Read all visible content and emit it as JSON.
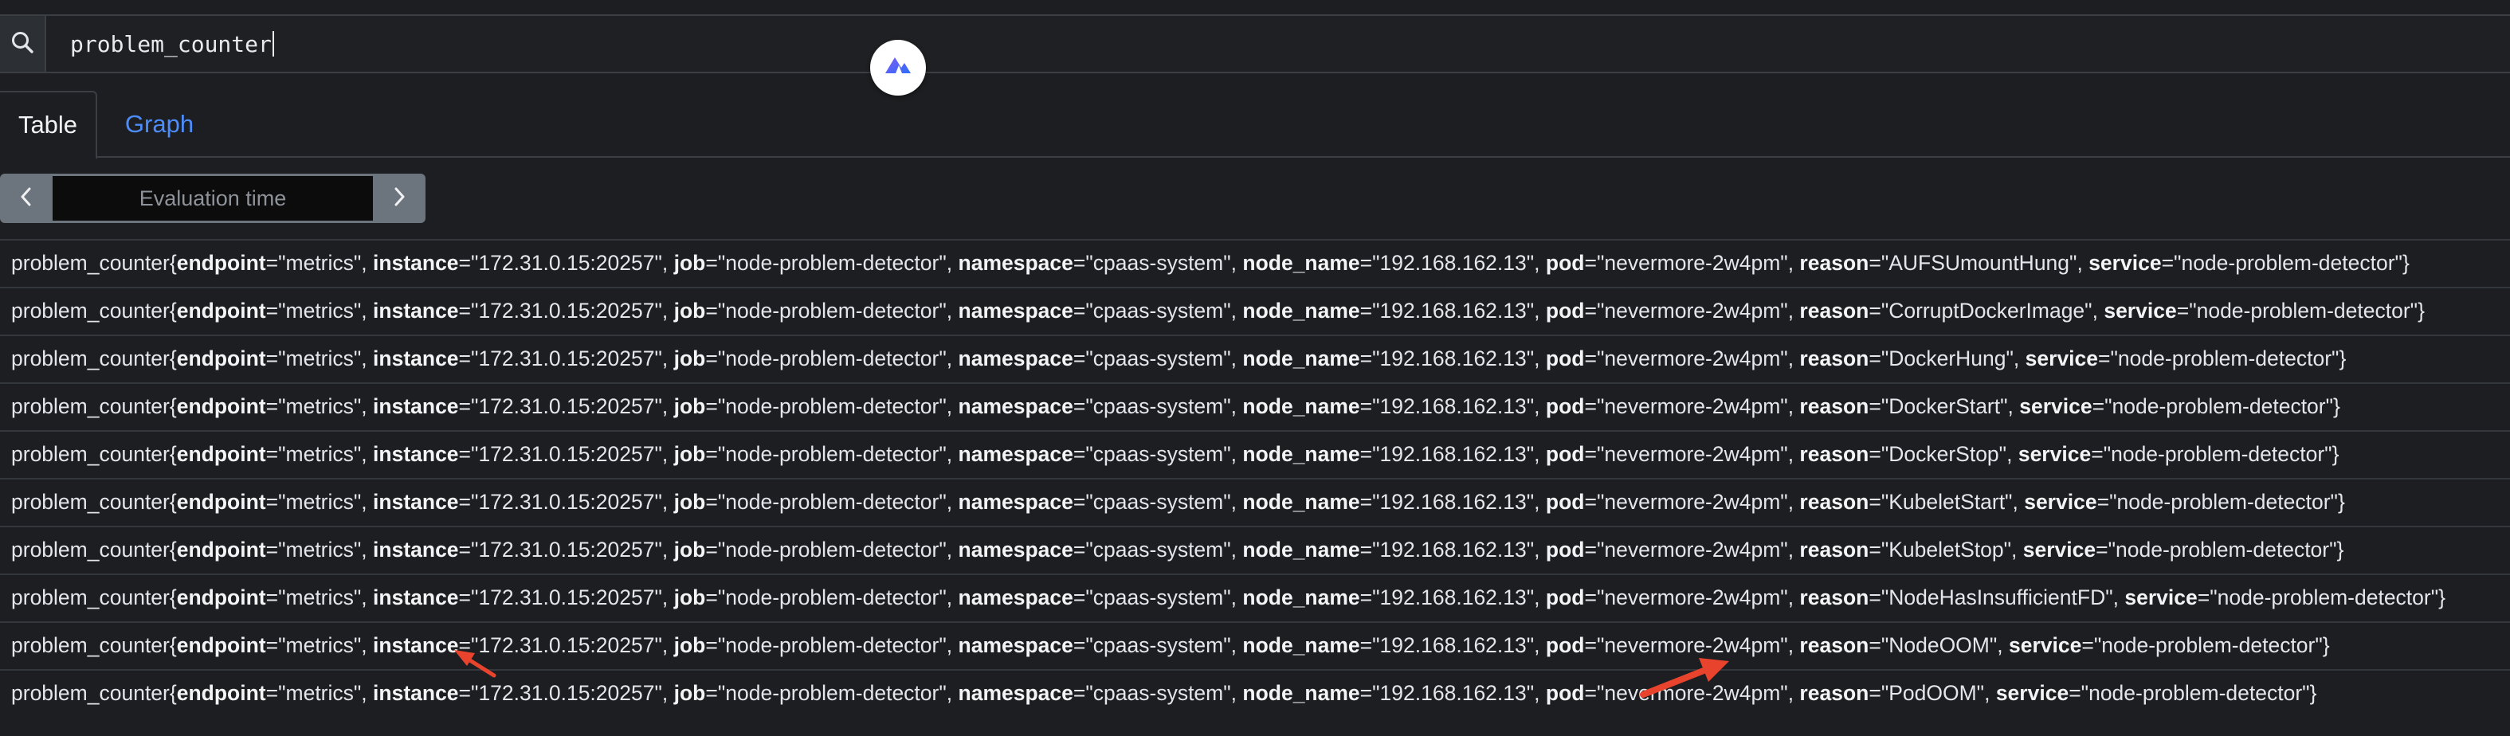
{
  "query": {
    "value": "problem_counter"
  },
  "icons": {
    "search": "search-icon",
    "extension": "extension-badge-icon",
    "prev": "chevron-left-icon",
    "next": "chevron-right-icon"
  },
  "tabs": {
    "table": "Table",
    "graph": "Graph"
  },
  "eval_time": {
    "placeholder": "Evaluation time"
  },
  "colors": {
    "accent": "#4d8dfb",
    "annotation_arrow": "#e8442d"
  },
  "labels": {
    "metric": "problem_counter",
    "endpoint_key": "endpoint",
    "instance_key": "instance",
    "job_key": "job",
    "namespace_key": "namespace",
    "node_name_key": "node_name",
    "pod_key": "pod",
    "reason_key": "reason",
    "service_key": "service",
    "endpoint_val": "\"metrics\"",
    "instance_val": "\"172.31.0.15:20257\"",
    "job_val": "\"node-problem-detector\"",
    "namespace_val": "\"cpaas-system\"",
    "node_name_val": "\"192.168.162.13\"",
    "pod_val": "\"nevermore-2w4pm\"",
    "service_val": "\"node-problem-detector\""
  },
  "rows": [
    {
      "reason": "\"AUFSUmountHung\""
    },
    {
      "reason": "\"CorruptDockerImage\""
    },
    {
      "reason": "\"DockerHung\""
    },
    {
      "reason": "\"DockerStart\""
    },
    {
      "reason": "\"DockerStop\""
    },
    {
      "reason": "\"KubeletStart\""
    },
    {
      "reason": "\"KubeletStop\""
    },
    {
      "reason": "\"NodeHasInsufficientFD\""
    },
    {
      "reason": "\"NodeOOM\""
    },
    {
      "reason": "\"PodOOM\""
    }
  ]
}
